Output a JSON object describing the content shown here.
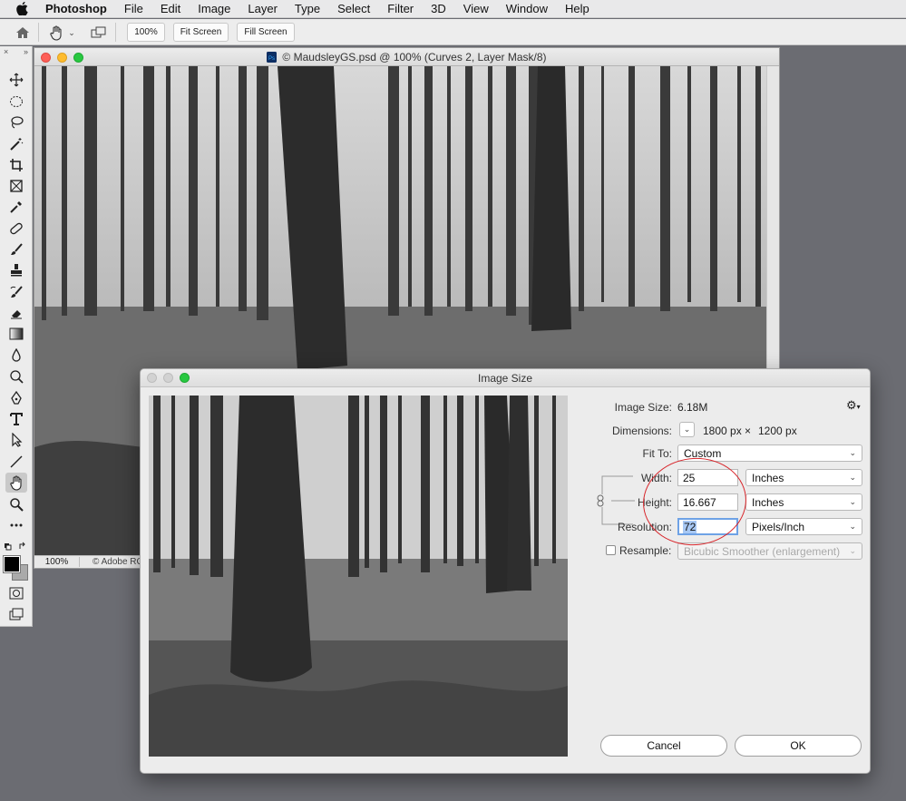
{
  "menubar": {
    "app_name": "Photoshop",
    "items": [
      "File",
      "Edit",
      "Image",
      "Layer",
      "Type",
      "Select",
      "Filter",
      "3D",
      "View",
      "Window",
      "Help"
    ]
  },
  "options": {
    "zoom_label": "100%",
    "fit_screen_label": "Fit Screen",
    "fill_screen_label": "Fill Screen"
  },
  "toolbox": {
    "header_left": "×",
    "header_right": "»"
  },
  "document": {
    "title": "© MaudsleyGS.psd @ 100% (Curves 2, Layer Mask/8)",
    "status_zoom": "100%",
    "status_info": "© Adobe RG"
  },
  "dialog": {
    "title": "Image Size",
    "image_size_label": "Image Size:",
    "image_size_value": "6.18M",
    "dimensions_label": "Dimensions:",
    "dim_width": "1800 px",
    "dim_x": "×",
    "dim_height": "1200 px",
    "fit_to_label": "Fit To:",
    "fit_to_value": "Custom",
    "width_label": "Width:",
    "width_value": "25",
    "width_unit": "Inches",
    "height_label": "Height:",
    "height_value": "16.667",
    "height_unit": "Inches",
    "resolution_label": "Resolution:",
    "resolution_value": "72",
    "resolution_unit": "Pixels/Inch",
    "resample_label": "Resample:",
    "resample_value": "Bicubic Smoother (enlargement)",
    "resample_checked": false,
    "cancel_label": "Cancel",
    "ok_label": "OK"
  },
  "colors": {
    "annotation": "#d8252a",
    "traffic_close": "#fe5f57",
    "traffic_min": "#febc2e",
    "traffic_max": "#28c840"
  }
}
